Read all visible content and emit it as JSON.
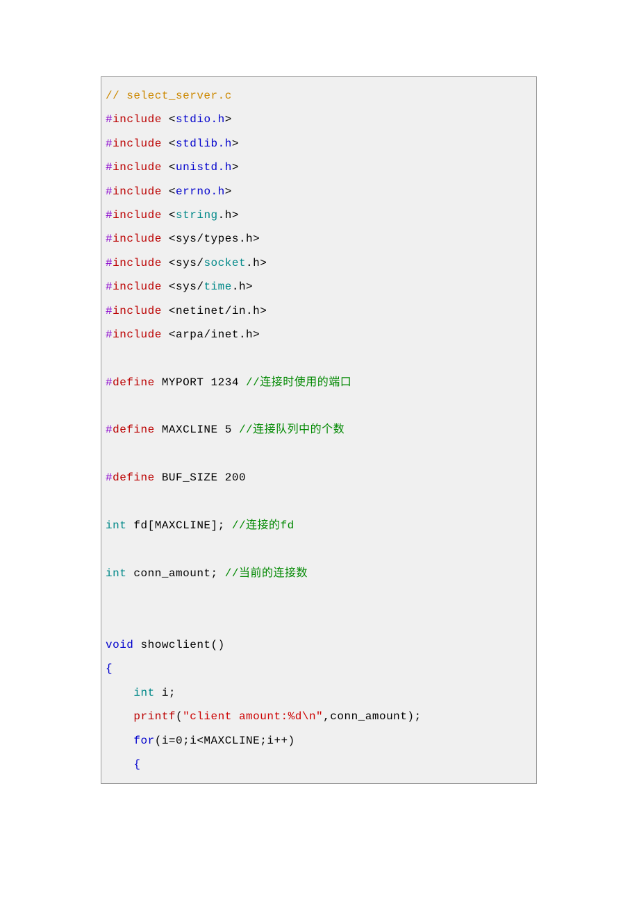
{
  "code": {
    "l0": {
      "a": "// select_server.c"
    },
    "l1": {
      "a": "#",
      "b": "include",
      "c": " <",
      "d": "stdio.h",
      "e": ">"
    },
    "l2": {
      "a": "#",
      "b": "include",
      "c": " <",
      "d": "stdlib.h",
      "e": ">"
    },
    "l3": {
      "a": "#",
      "b": "include",
      "c": " <",
      "d": "unistd.h",
      "e": ">"
    },
    "l4": {
      "a": "#",
      "b": "include",
      "c": " <",
      "d": "errno.h",
      "e": ">"
    },
    "l5": {
      "a": "#",
      "b": "include",
      "c": " <",
      "d": "string",
      "e": ".h>"
    },
    "l6": {
      "a": "#",
      "b": "include",
      "c": " <sys/types.h>"
    },
    "l7": {
      "a": "#",
      "b": "include",
      "c": " <sys/",
      "d": "socket",
      "e": ".h>"
    },
    "l8": {
      "a": "#",
      "b": "include",
      "c": " <sys/",
      "d": "time",
      "e": ".h>"
    },
    "l9": {
      "a": "#",
      "b": "include",
      "c": " <netinet/in.h>"
    },
    "l10": {
      "a": "#",
      "b": "include",
      "c": " <arpa/inet.h>"
    },
    "l11": {
      "a": "#",
      "b": "define",
      "c": " MYPORT 1234 ",
      "d": "//连接时使用的端口"
    },
    "l12": {
      "a": "#",
      "b": "define",
      "c": " MAXCLINE 5 ",
      "d": "//连接队列中的个数"
    },
    "l13": {
      "a": "#",
      "b": "define",
      "c": " BUF_SIZE 200"
    },
    "l14": {
      "a": "int",
      "b": " fd[MAXCLINE]; ",
      "c": "//连接的",
      "d": "fd"
    },
    "l15": {
      "a": "int",
      "b": " conn_amount; ",
      "c": "//当前的连接数"
    },
    "l16": {
      "a": "void",
      "b": " showclient()"
    },
    "l17": {
      "a": "{"
    },
    "l18": {
      "a": "    ",
      "b": "int",
      "c": " i;"
    },
    "l19": {
      "a": "    ",
      "b": "printf",
      "c": "(",
      "d": "\"client amount:%d\\n\"",
      "e": ",conn_amount);"
    },
    "l20": {
      "a": "    ",
      "b": "for",
      "c": "(i=0;i<MAXCLINE;i++)"
    },
    "l21": {
      "a": "    {"
    }
  }
}
